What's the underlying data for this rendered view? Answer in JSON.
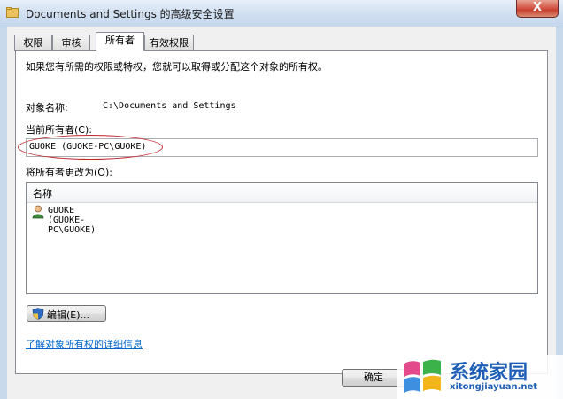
{
  "window": {
    "title": "Documents and Settings 的高级安全设置",
    "close_glyph": "X"
  },
  "tabs": [
    {
      "label": "权限",
      "active": false
    },
    {
      "label": "审核",
      "active": false
    },
    {
      "label": "所有者",
      "active": true
    },
    {
      "label": "有效权限",
      "active": false
    }
  ],
  "owner_tab": {
    "intro": "如果您有所需的权限或特权，您就可以取得或分配这个对象的所有权。",
    "object_name_label": "对象名称:",
    "object_name_value": "C:\\Documents and Settings",
    "current_owner_label": "当前所有者(C):",
    "current_owner_value": "GUOKE (GUOKE-PC\\GUOKE)",
    "change_owner_label": "将所有者更改为(O):",
    "list_column_name": "名称",
    "list_items": [
      "GUOKE (GUOKE-PC\\GUOKE)"
    ],
    "edit_button": "编辑(E)...",
    "learn_more_link": "了解对象所有权的详细信息"
  },
  "footer": {
    "ok_button": "确定"
  },
  "watermark": {
    "name": "系统家园",
    "url": "xitongjiayuan.net"
  },
  "colors": {
    "annotation_ellipse": "#c0262a",
    "link": "#0066cc",
    "close_button": "#c7402f"
  }
}
